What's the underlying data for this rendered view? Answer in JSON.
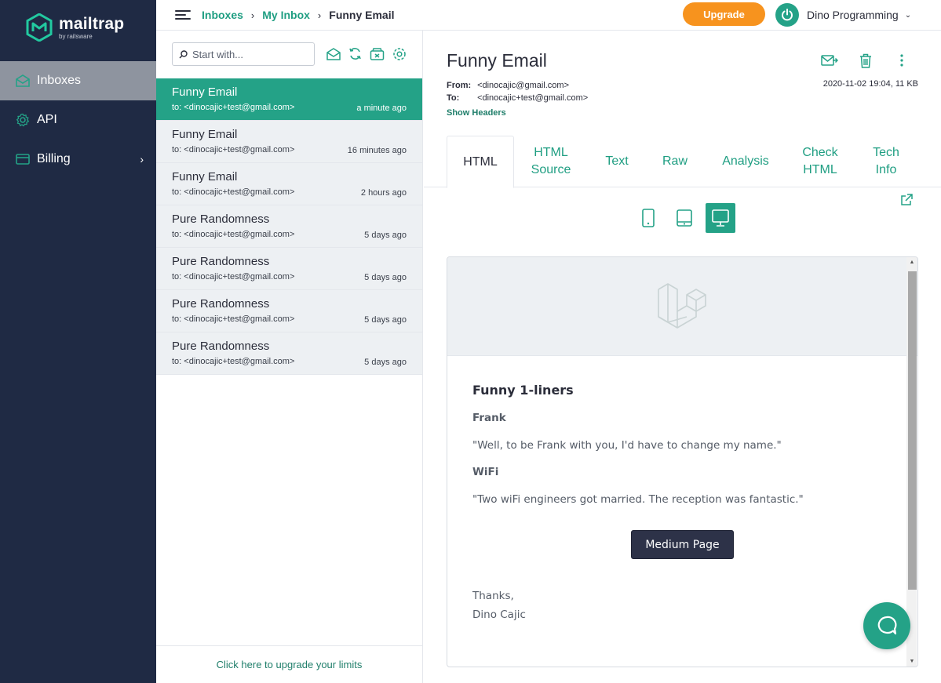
{
  "app": {
    "logo_name": "mailtrap",
    "logo_sub": "by railsware"
  },
  "sidebar": {
    "items": [
      {
        "label": "Inboxes",
        "icon": "inbox-icon",
        "active": true
      },
      {
        "label": "API",
        "icon": "gear-icon",
        "active": false
      },
      {
        "label": "Billing",
        "icon": "card-icon",
        "active": false,
        "chevron": "›"
      }
    ]
  },
  "topbar": {
    "breadcrumb": [
      "Inboxes",
      "My Inbox",
      "Funny Email"
    ],
    "separator": "›",
    "upgrade_label": "Upgrade",
    "user_name": "Dino Programming",
    "user_chevron": "⌄"
  },
  "list": {
    "search_placeholder": "Start with...",
    "messages": [
      {
        "subject": "Funny Email",
        "to": "to: <dinocajic+test@gmail.com>",
        "time": "a minute ago"
      },
      {
        "subject": "Funny Email",
        "to": "to: <dinocajic+test@gmail.com>",
        "time": "16 minutes ago"
      },
      {
        "subject": "Funny Email",
        "to": "to: <dinocajic+test@gmail.com>",
        "time": "2 hours ago"
      },
      {
        "subject": "Pure Randomness",
        "to": "to: <dinocajic+test@gmail.com>",
        "time": "5 days ago"
      },
      {
        "subject": "Pure Randomness",
        "to": "to: <dinocajic+test@gmail.com>",
        "time": "5 days ago"
      },
      {
        "subject": "Pure Randomness",
        "to": "to: <dinocajic+test@gmail.com>",
        "time": "5 days ago"
      },
      {
        "subject": "Pure Randomness",
        "to": "to: <dinocajic+test@gmail.com>",
        "time": "5 days ago"
      }
    ],
    "footer_link": "Click here to upgrade your limits"
  },
  "detail": {
    "subject": "Funny Email",
    "from_label": "From:",
    "from": "<dinocajic@gmail.com>",
    "to_label": "To:",
    "to": "<dinocajic+test@gmail.com>",
    "date_size": "2020-11-02 19:04, 11 KB",
    "show_headers": "Show Headers",
    "tabs": [
      {
        "label": "HTML",
        "active": true
      },
      {
        "label": "HTML Source"
      },
      {
        "label": "Text"
      },
      {
        "label": "Raw"
      },
      {
        "label": "Analysis"
      },
      {
        "label": "Check HTML"
      },
      {
        "label": "Tech Info"
      }
    ]
  },
  "preview": {
    "title": "Funny 1-liners",
    "heading1": "Frank",
    "text1": "\"Well, to be Frank with you, I'd have to change my name.\"",
    "heading2": "WiFi",
    "text2": "\"Two wiFi engineers got married. The reception was fantastic.\"",
    "button": "Medium Page",
    "sign_line1": "Thanks,",
    "sign_line2": "Dino Cajic"
  },
  "colors": {
    "accent": "#24a287",
    "sidebar": "#1f2a44",
    "upgrade": "#f7931e"
  }
}
